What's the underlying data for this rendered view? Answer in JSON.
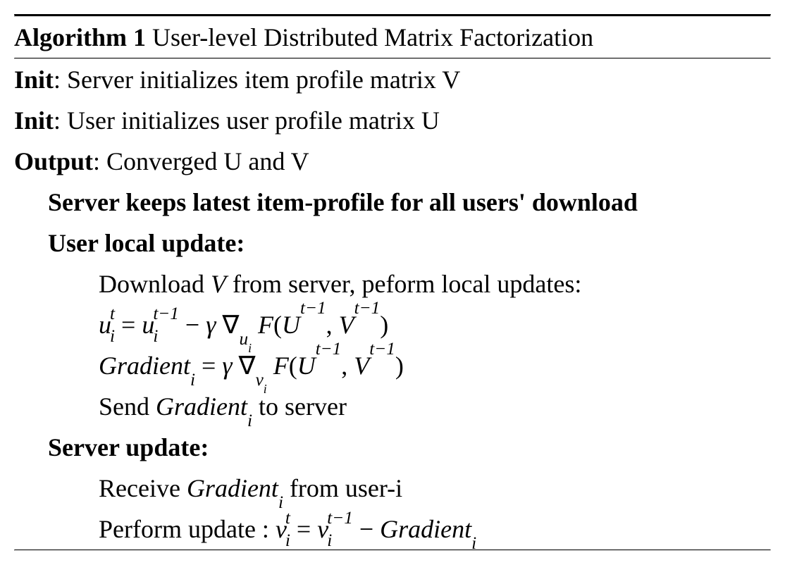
{
  "algorithm": {
    "header_prefix": "Algorithm 1",
    "header_title": " User-level Distributed Matrix Factorization",
    "init1_prefix": "Init",
    "init1_text": ": Server initializes item profile matrix V",
    "init2_prefix": "Init",
    "init2_text": ": User initializes user profile matrix U",
    "output_prefix": "Output",
    "output_text": ": Converged U and V",
    "server_keeps": "Server keeps latest item-profile for all users' download",
    "user_local_update": "User local update:",
    "download_prefix": "Download ",
    "download_var": "V",
    "download_suffix": " from server, peform local updates:",
    "send_prefix": "Send ",
    "send_var": "Gradient",
    "send_sub": "i",
    "send_suffix": " to server",
    "server_update": "Server update:",
    "receive_prefix": "Receive ",
    "receive_var": "Gradient",
    "receive_sub": "i",
    "receive_suffix": " from user-i",
    "perform_prefix": "Perform update : ",
    "math": {
      "u": "u",
      "U": "U",
      "v": "v",
      "V": "V",
      "F": "F",
      "i": "i",
      "t": "t",
      "tm1": "t−1",
      "gamma": "γ",
      "nabla": "∇",
      "eq": " = ",
      "minus": " − ",
      "lparen": "(",
      "rparen": ")",
      "comma": ", ",
      "Gradient": "Gradient"
    }
  }
}
